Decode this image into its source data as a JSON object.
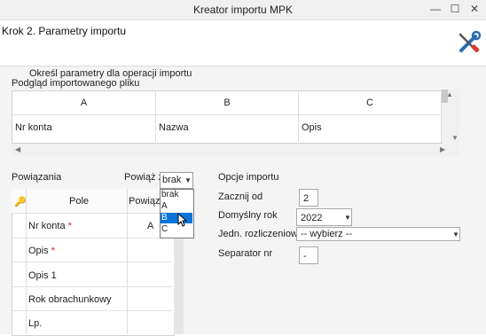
{
  "window": {
    "title": "Kreator importu MPK",
    "minimize": "—",
    "maximize": "☐",
    "close": "✕"
  },
  "header": {
    "step": "Krok 2. Parametry importu",
    "tool_icon": "tools-icon"
  },
  "instructions": "Określ parametry dla operacji importu",
  "preview": {
    "title": "Podgląd importowanego pliku",
    "columns": [
      "A",
      "B",
      "C"
    ],
    "rows": [
      [
        "Nr konta",
        "Nazwa",
        "Opis"
      ]
    ]
  },
  "bindings": {
    "title": "Powiązania",
    "bind_label": "Powiąż z:",
    "bind_value": "brak",
    "options": [
      "brak",
      "A",
      "B",
      "C"
    ],
    "highlighted_option": "B",
    "table": {
      "headers": [
        "Pole",
        "Powiązan"
      ],
      "rows": [
        {
          "field": "Nr konta",
          "required": true,
          "req_mark": "*",
          "binding": "A"
        },
        {
          "field": "Opis",
          "required": true,
          "req_mark": "*",
          "binding": ""
        },
        {
          "field": "Opis 1",
          "required": false,
          "req_mark": "",
          "binding": ""
        },
        {
          "field": "Rok obrachunkowy",
          "required": false,
          "req_mark": "",
          "binding": ""
        },
        {
          "field": "Lp.",
          "required": false,
          "req_mark": "",
          "binding": ""
        }
      ]
    }
  },
  "import_options": {
    "title": "Opcje importu",
    "start_from_label": "Zacznij od",
    "start_from_value": "2",
    "default_year_label": "Domyślny rok",
    "default_year_value": "2022",
    "unit_label": "Jedn. rozliczeniowa:",
    "unit_value": "-- wybierz --",
    "separator_label": "Separator nr",
    "separator_value": "-"
  },
  "colors": {
    "accent": "#0a74da",
    "required": "#d32020",
    "tool_red": "#d63a2a",
    "tool_blue": "#2b6cb0"
  }
}
